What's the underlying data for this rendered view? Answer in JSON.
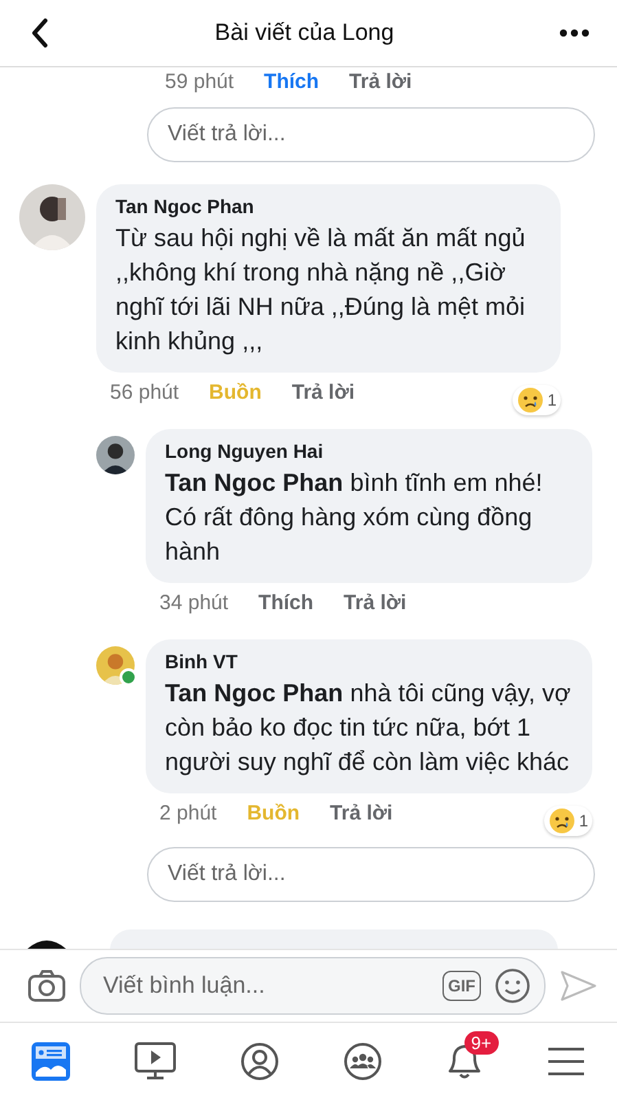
{
  "header": {
    "title": "Bài viết của Long"
  },
  "previous_thread": {
    "time": "59 phút",
    "reaction": {
      "kind": "like",
      "label": "Thích"
    },
    "reply": "Trả lời",
    "reply_placeholder": "Viết trả lời..."
  },
  "comments": [
    {
      "author": "Tan Ngoc Phan",
      "text": "Từ sau hội nghị về là mất ăn mất ngủ ,,không khí trong nhà nặng nề ,,Giờ nghĩ tới lãi NH nữa ,,Đúng là mệt mỏi kinh khủng ,,,",
      "time": "56 phút",
      "reaction": {
        "kind": "sad",
        "label": "Buồn"
      },
      "reply": "Trả lời",
      "badge": {
        "kind": "sad",
        "count": "1"
      },
      "children": [
        {
          "author": "Long Nguyen Hai",
          "text": "**Tan Ngoc Phan** bình tĩnh em nhé! Có rất đông hàng xóm cùng đồng hành",
          "time": "34 phút",
          "reaction": {
            "kind": "none",
            "label": "Thích"
          },
          "reply": "Trả lời"
        },
        {
          "author": "Binh VT",
          "text": "**Tan Ngoc Phan** nhà tôi cũng vậy, vợ còn bảo ko đọc tin tức nữa, bớt 1 người suy nghĩ để còn làm việc khác",
          "time": "2 phút",
          "reaction": {
            "kind": "sad",
            "label": "Buồn"
          },
          "reply": "Trả lời",
          "badge": {
            "kind": "sad",
            "count": "1"
          },
          "online": true
        }
      ],
      "reply_placeholder": "Viết trả lời..."
    }
  ],
  "composer": {
    "placeholder": "Viết bình luận...",
    "gif": "GIF"
  },
  "tabs": [
    {
      "kind": "feed",
      "selected": true
    },
    {
      "kind": "video",
      "selected": false
    },
    {
      "kind": "profile",
      "selected": false
    },
    {
      "kind": "groups",
      "selected": false
    },
    {
      "kind": "notifications",
      "selected": false,
      "badge": "9+"
    },
    {
      "kind": "menu",
      "selected": false
    }
  ]
}
